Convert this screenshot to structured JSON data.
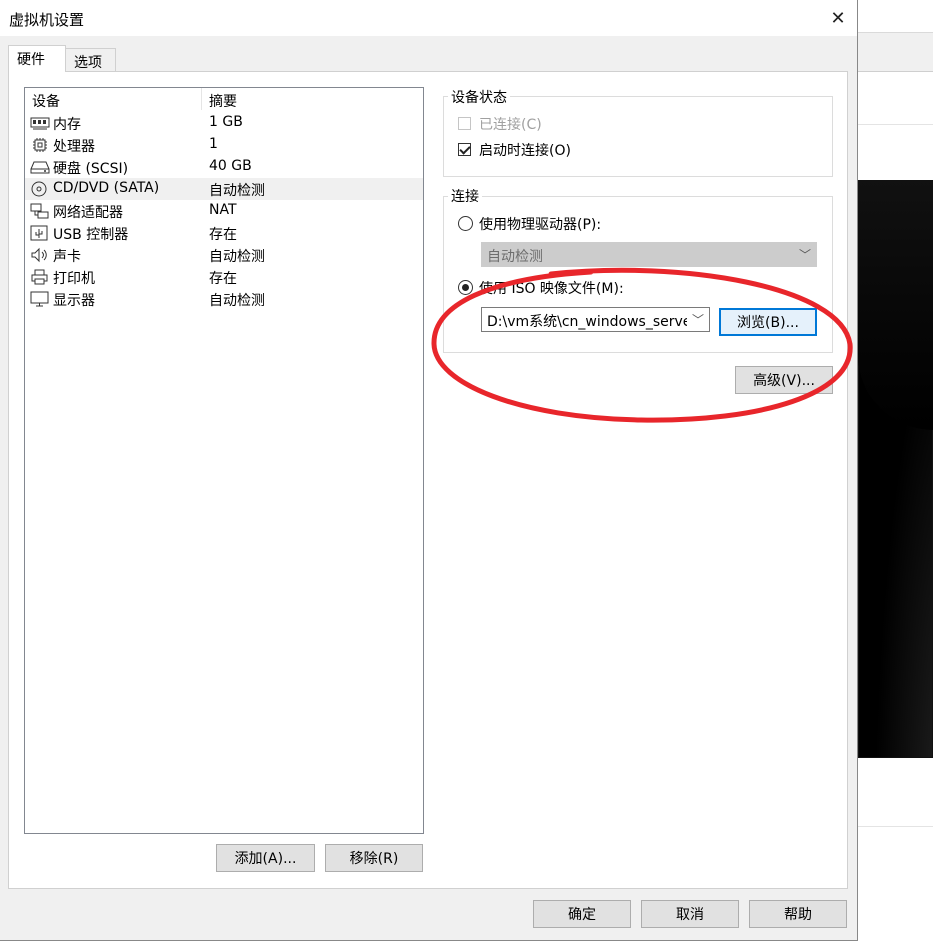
{
  "window": {
    "title": "虚拟机设置",
    "close_glyph": "✕"
  },
  "tabs": [
    {
      "label": "硬件"
    },
    {
      "label": "选项"
    }
  ],
  "device_list": {
    "header": {
      "device": "设备",
      "summary": "摘要"
    },
    "rows": [
      {
        "icon": "memory-icon",
        "name": "内存",
        "summary": "1 GB"
      },
      {
        "icon": "cpu-icon",
        "name": "处理器",
        "summary": "1"
      },
      {
        "icon": "hard-disk-icon",
        "name": "硬盘 (SCSI)",
        "summary": "40 GB"
      },
      {
        "icon": "cd-dvd-icon",
        "name": "CD/DVD (SATA)",
        "summary": "自动检测",
        "selected": true
      },
      {
        "icon": "network-adapter-icon",
        "name": "网络适配器",
        "summary": "NAT"
      },
      {
        "icon": "usb-icon",
        "name": "USB 控制器",
        "summary": "存在"
      },
      {
        "icon": "sound-card-icon",
        "name": "声卡",
        "summary": "自动检测"
      },
      {
        "icon": "printer-icon",
        "name": "打印机",
        "summary": "存在"
      },
      {
        "icon": "display-icon",
        "name": "显示器",
        "summary": "自动检测"
      }
    ],
    "add_label": "添加(A)...",
    "remove_label": "移除(R)"
  },
  "device_status": {
    "title": "设备状态",
    "connected_label": "已连接(C)",
    "connected_checked": false,
    "connected_enabled": false,
    "connect_at_power_on_label": "启动时连接(O)",
    "connect_at_power_on_checked": true
  },
  "connection": {
    "title": "连接",
    "physical_drive_label": "使用物理驱动器(P):",
    "physical_drive_value": "自动检测",
    "iso_label": "使用 ISO 映像文件(M):",
    "iso_value": "D:\\vm系统\\cn_windows_serve",
    "browse_label": "浏览(B)...",
    "selected": "iso"
  },
  "advanced_label": "高级(V)...",
  "footer": {
    "ok": "确定",
    "cancel": "取消",
    "help": "帮助"
  },
  "colors": {
    "annotation": "#e8262b",
    "focus": "#0078d7"
  }
}
